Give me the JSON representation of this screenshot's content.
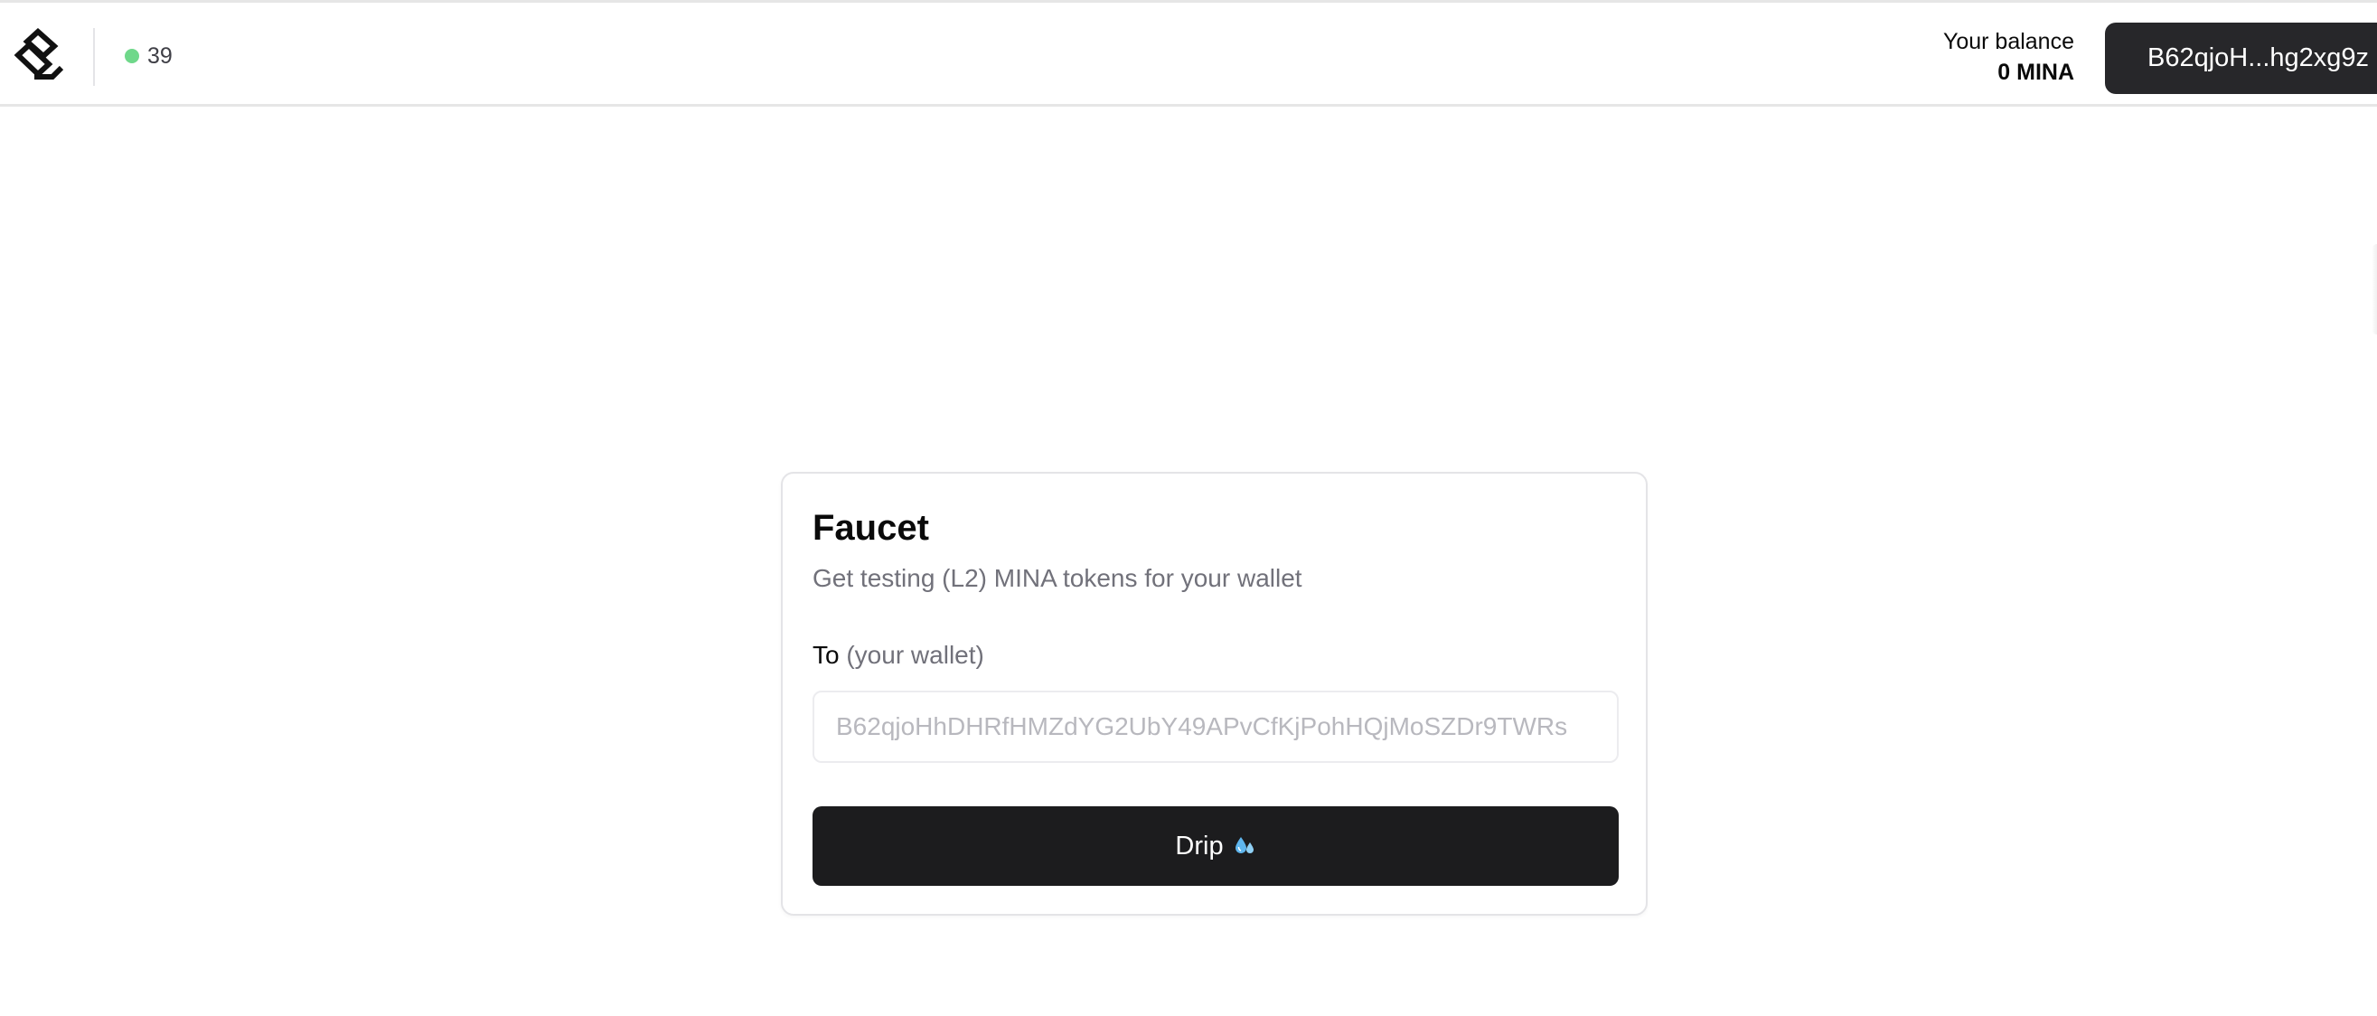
{
  "header": {
    "logo_icon": "protokit-logo-icon",
    "status": {
      "count": "39",
      "dot_color": "#6fd88a"
    },
    "balance": {
      "label": "Your balance",
      "value": "0 MINA"
    },
    "wallet_button_label": "B62qjoH...hg2xg9z"
  },
  "faucet": {
    "title": "Faucet",
    "subtitle": "Get testing (L2) MINA tokens for your wallet",
    "field_label": "To",
    "field_hint": "(your wallet)",
    "address_placeholder": "B62qjoHhDHRfHMZdYG2UbY49APvCfKjPohHQjMoSZDr9TWRs",
    "drip_label": "Drip",
    "drip_icon": "sweat-droplets-icon"
  },
  "colors": {
    "button_dark": "#1c1c1e",
    "wallet_button": "#27272a",
    "muted_text": "#71717a"
  }
}
